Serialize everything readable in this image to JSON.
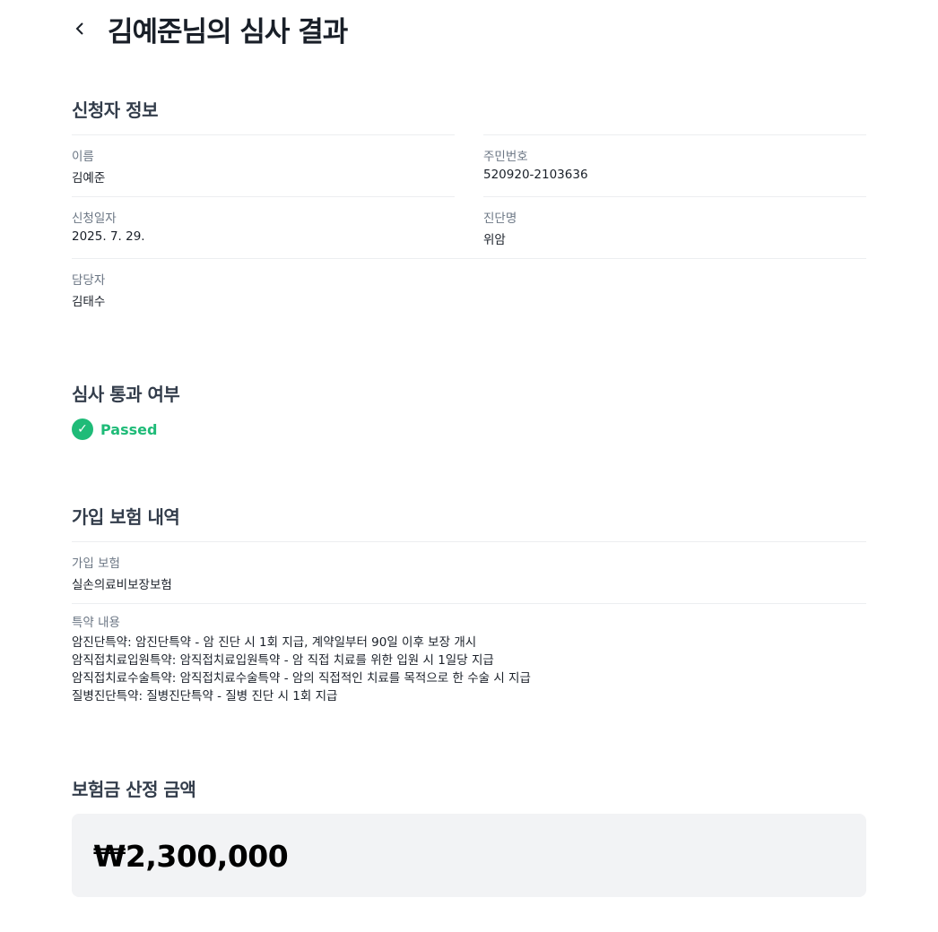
{
  "header": {
    "title": "김예준님의 심사 결과"
  },
  "applicant": {
    "heading": "신청자 정보",
    "fields": [
      {
        "label": "이름",
        "value": "김예준"
      },
      {
        "label": "주민번호",
        "value": "520920-2103636"
      },
      {
        "label": "신청일자",
        "value": "2025. 7. 29."
      },
      {
        "label": "진단명",
        "value": "위암"
      },
      {
        "label": "담당자",
        "value": "김태수"
      }
    ]
  },
  "review": {
    "heading": "심사 통과 여부",
    "status": "Passed",
    "status_color": "#1fbb78"
  },
  "insurance": {
    "heading": "가입 보험 내역",
    "product_label": "가입 보험",
    "product_value": "실손의료비보장보험",
    "riders_label": "특약 내용",
    "riders": [
      "암진단특약: 암진단특약 - 암 진단 시 1회 지급, 계약일부터 90일 이후 보장 개시",
      "암직접치료입원특약: 암직접치료입원특약 - 암 직접 치료를 위한 입원 시 1일당 지급",
      "암직접치료수술특약: 암직접치료수술특약 - 암의 직접적인 치료를 목적으로 한 수술 시 지급",
      "질병진단특약: 질병진단특약 - 질병 진단 시 1회 지급"
    ]
  },
  "payout": {
    "heading": "보험금 산정 금액",
    "amount": "₩2,300,000"
  }
}
